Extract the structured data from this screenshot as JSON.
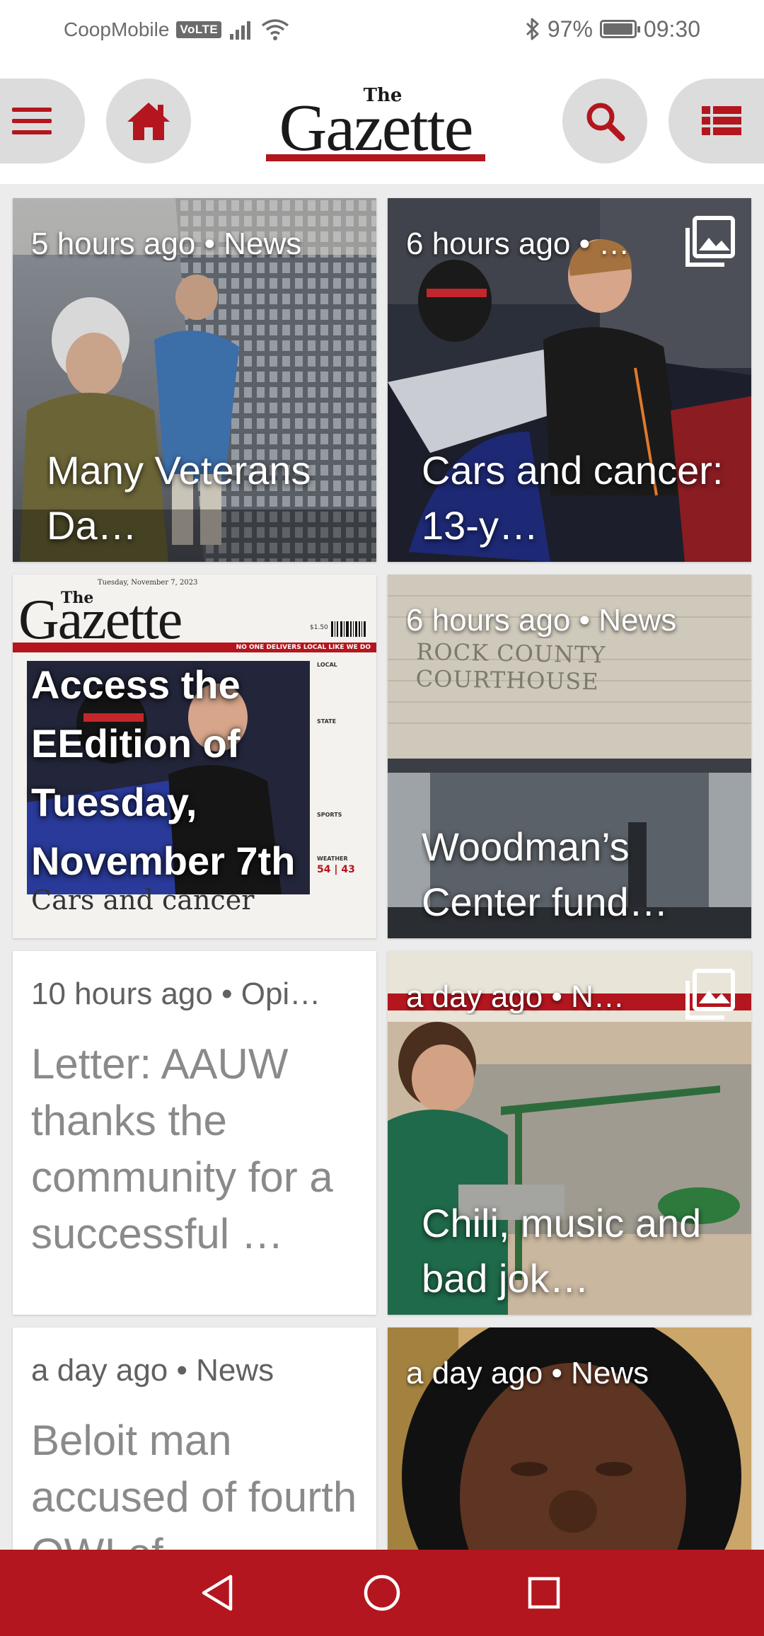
{
  "status_bar": {
    "carrier": "CoopMobile",
    "volte": "VoLTE",
    "battery": "97%",
    "battery_level": 0.97,
    "time": "09:30"
  },
  "header": {
    "logo_the": "The",
    "logo_name": "Gazette",
    "icons": [
      "menu-icon",
      "home-icon",
      "search-icon",
      "list-icon"
    ]
  },
  "colors": {
    "brand_red": "#b3161e",
    "icon_button_bg": "#dcdcdc"
  },
  "feed": {
    "cards": [
      {
        "meta": "5 hours ago • News",
        "title": "Many Veterans Da…",
        "gallery": false
      },
      {
        "meta": "6 hours ago • …",
        "title": "Cars and cancer: 13-y…",
        "gallery": true
      },
      {
        "meta": "",
        "title": "Access the EEdition of Tuesday, November 7th",
        "gallery": false
      },
      {
        "meta": "6 hours ago • News",
        "title": "Woodman’s Center fund…",
        "gallery": false
      },
      {
        "meta": "10 hours ago • Opi…",
        "title": "Letter: AAUW thanks the community for a successful …",
        "gallery": false
      },
      {
        "meta": "a day ago • N…",
        "title": "Chili, music and bad jok…",
        "gallery": true
      },
      {
        "meta": "a day ago • News",
        "title": "Beloit man accused of fourth OWI of…",
        "gallery": false
      },
      {
        "meta": "a day ago • News",
        "title": "",
        "gallery": false
      }
    ],
    "eedition_cover": {
      "date": "Tuesday, November 7, 2023",
      "masthead_the": "The",
      "masthead_name": "Gazette",
      "price": "$1.50",
      "ribbon": "No One Delivers Local Like We Do",
      "headline": "Cars and cancer",
      "sidebar": [
        "LOCAL",
        "STATE",
        "SPORTS",
        "WEATHER"
      ],
      "temps": "54 | 43"
    },
    "courthouse_sign": "ROCK COUNTY COURTHOUSE"
  },
  "nav_bar": {
    "buttons": [
      "back-icon",
      "home-circle-icon",
      "recents-icon"
    ]
  }
}
